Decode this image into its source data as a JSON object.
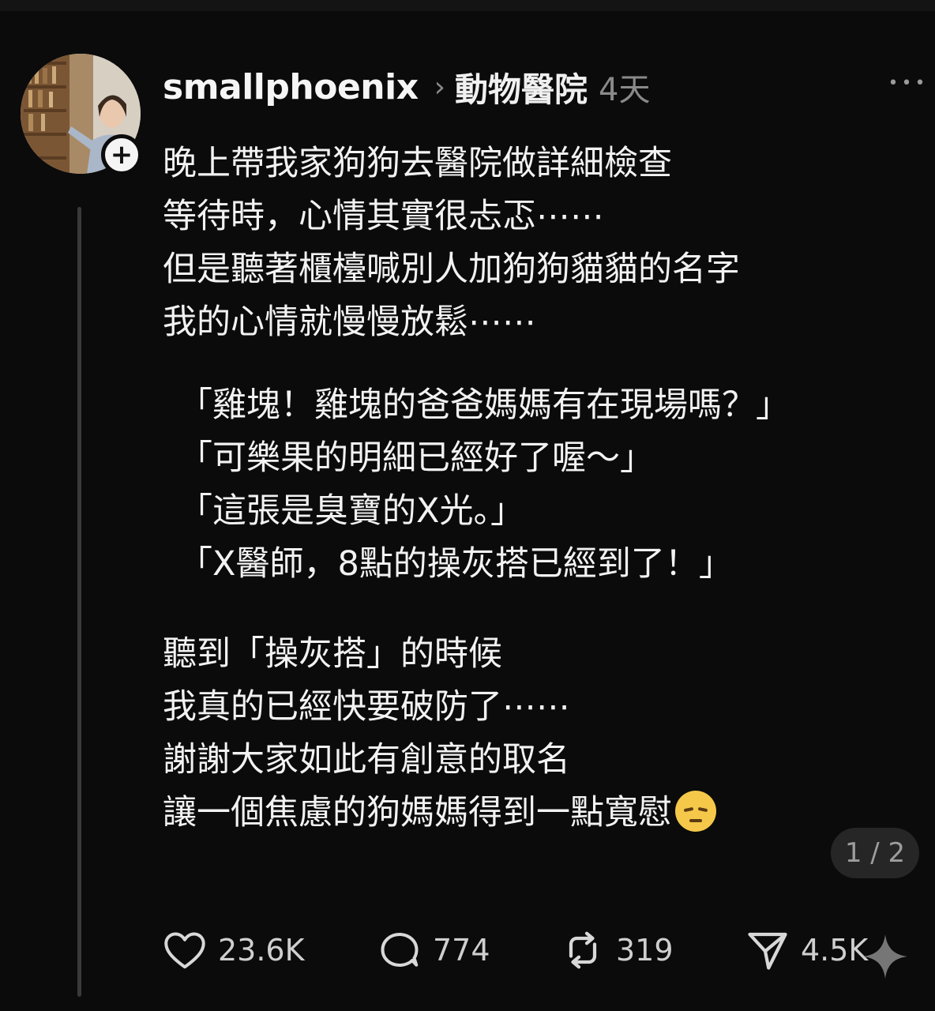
{
  "post": {
    "username": "smallphoenix",
    "topic": "動物醫院",
    "time": "4天",
    "lines": [
      "晚上帶我家狗狗去醫院做詳細檢查",
      "等待時，心情其實很忐忑⋯⋯",
      "但是聽著櫃檯喊別人加狗狗貓貓的名字",
      "我的心情就慢慢放鬆⋯⋯"
    ],
    "quotes": [
      "「雞塊！雞塊的爸爸媽媽有在現場嗎？」",
      "「可樂果的明細已經好了喔～」",
      "「這張是臭寶的X光。」",
      "「X醫師，8點的操灰搭已經到了！」"
    ],
    "ending": [
      "聽到「操灰搭」的時候",
      "我真的已經快要破防了⋯⋯",
      "謝謝大家如此有創意的取名",
      "讓一個焦慮的狗媽媽得到一點寬慰"
    ],
    "page_indicator": "1 / 2"
  },
  "actions": {
    "likes": "23.6K",
    "comments": "774",
    "reposts": "319",
    "shares": "4.5K"
  },
  "icons": {
    "follow": "plus-icon",
    "more": "more-options-icon",
    "like": "heart-icon",
    "comment": "comment-bubble-icon",
    "repost": "repost-icon",
    "share": "send-icon",
    "emoji": "pensive-face-emoji"
  }
}
